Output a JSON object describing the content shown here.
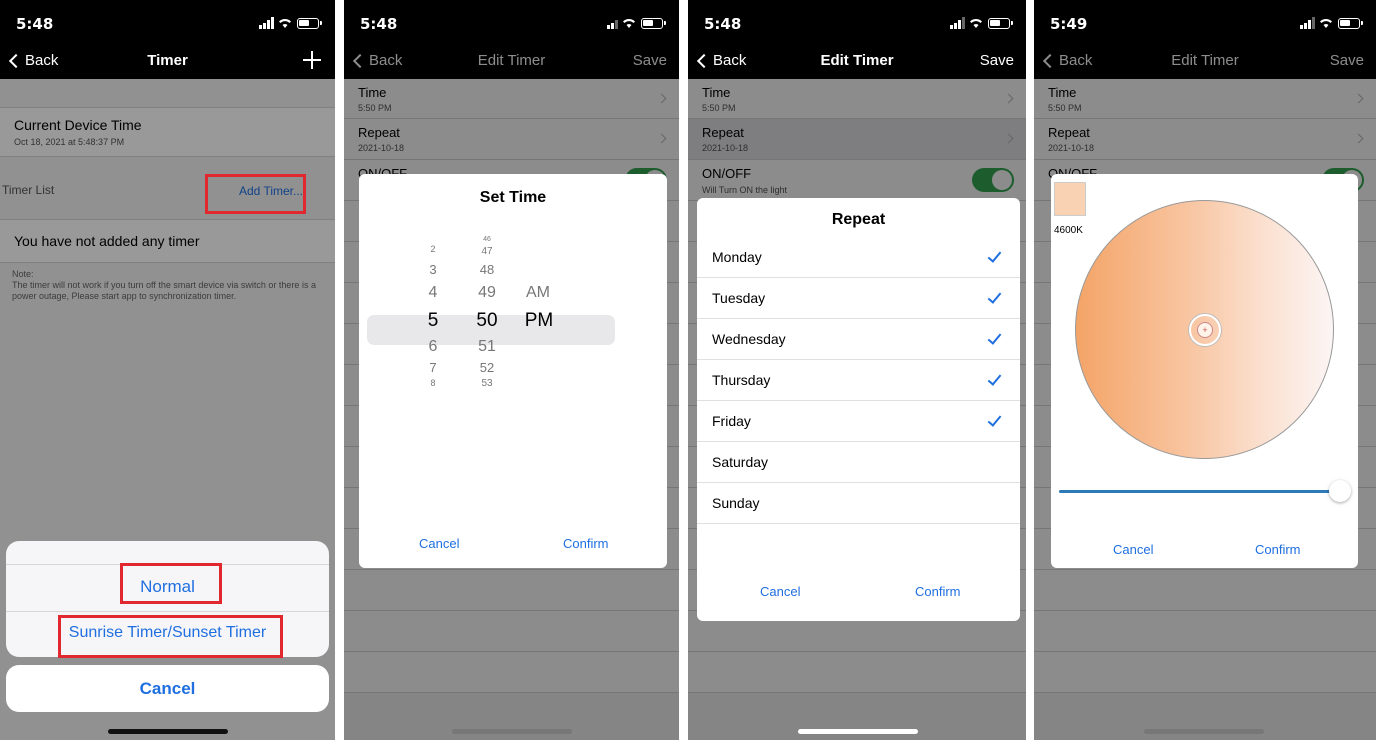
{
  "status_time_1": "5:48",
  "status_time_2": "5:48",
  "status_time_3": "5:48",
  "status_time_4": "5:49",
  "screen1": {
    "back": "Back",
    "title": "Timer",
    "device_time_title": "Current Device Time",
    "device_time_value": "Oct 18, 2021 at 5:48:37 PM",
    "timer_list_label": "Timer List",
    "add_timer": "Add Timer...",
    "empty_msg": "You have not added any timer",
    "note": "Note:\nThe timer will not work if you turn off the smart device via switch or there is a power outage, Please start app to synchronization timer.",
    "sheet_normal": "Normal",
    "sheet_sunrise": "Sunrise Timer/Sunset Timer",
    "sheet_cancel": "Cancel"
  },
  "edit": {
    "back": "Back",
    "title": "Edit Timer",
    "save": "Save",
    "time_label": "Time",
    "time_value": "5:50 PM",
    "repeat_label": "Repeat",
    "repeat_value": "2021-10-18",
    "onoff_label": "ON/OFF",
    "onoff_value": "Will Turn ON the light"
  },
  "screen2": {
    "modal_title": "Set Time",
    "hours": [
      "2",
      "3",
      "4",
      "5",
      "6",
      "7",
      "8"
    ],
    "minutes": [
      "46",
      "47",
      "48",
      "49",
      "50",
      "51",
      "52",
      "53"
    ],
    "ampm": [
      "AM",
      "PM"
    ],
    "cancel": "Cancel",
    "confirm": "Confirm"
  },
  "screen3": {
    "modal_title": "Repeat",
    "days": [
      {
        "label": "Monday",
        "checked": true
      },
      {
        "label": "Tuesday",
        "checked": true
      },
      {
        "label": "Wednesday",
        "checked": true
      },
      {
        "label": "Thursday",
        "checked": true
      },
      {
        "label": "Friday",
        "checked": true
      },
      {
        "label": "Saturday",
        "checked": false
      },
      {
        "label": "Sunday",
        "checked": false
      }
    ],
    "cancel": "Cancel",
    "confirm": "Confirm"
  },
  "screen4": {
    "kelvin": "4600K",
    "swatch_color": "#f9d2b4",
    "slider_fraction": 1.0,
    "cancel": "Cancel",
    "confirm": "Confirm"
  },
  "colors": {
    "accent": "#1f6fe0",
    "highlight": "#e0282e",
    "toggle_on": "#34a853"
  }
}
